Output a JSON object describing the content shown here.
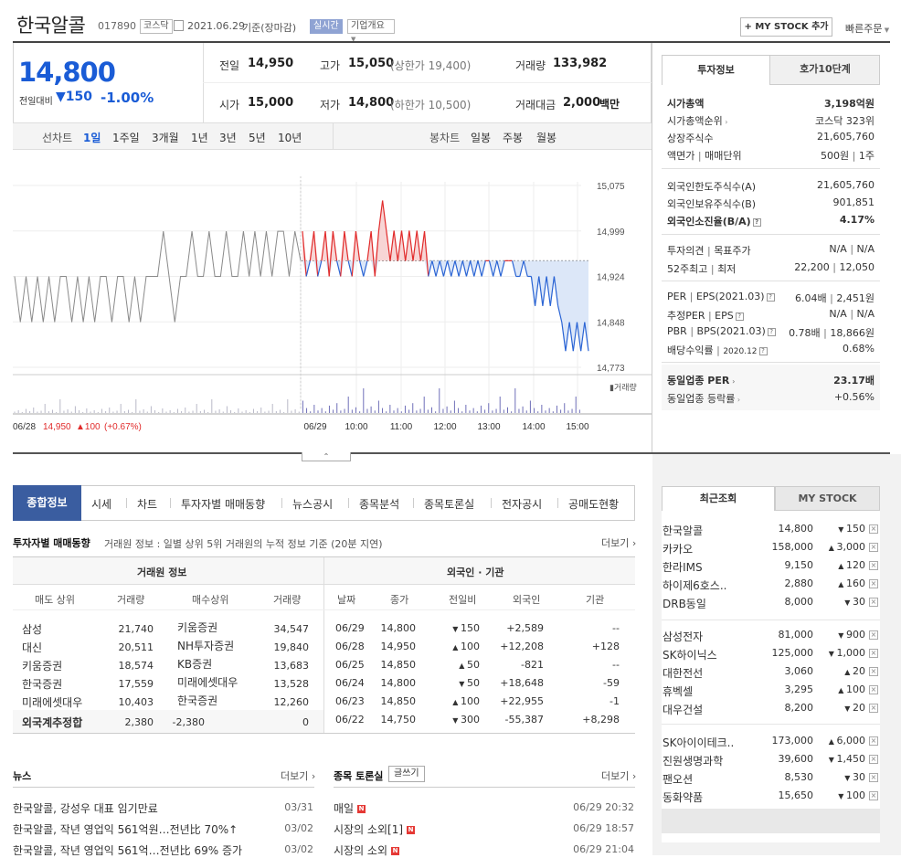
{
  "header": {
    "name": "한국알콜",
    "code": "017890",
    "market": "코스닥",
    "date": "2021.06.29",
    "basis": "기준(장마감)",
    "realtime": "실시간",
    "company_info": "기업개요",
    "mystock_btn": "MY STOCK 추가",
    "quick_order": "빠른주문"
  },
  "quote": {
    "price": "14,800",
    "change_label": "전일대비",
    "change": "150",
    "change_pct": "-1.00%",
    "prev_label": "전일",
    "prev": "14,950",
    "high_label": "고가",
    "high": "15,050",
    "upper_limit": "(상한가 19,400)",
    "volume_label": "거래량",
    "volume": "133,982",
    "open_label": "시가",
    "open": "15,000",
    "low_label": "저가",
    "low": "14,800",
    "lower_limit": "(하한가 10,500)",
    "amount_label": "거래대금",
    "amount": "2,000",
    "amount_unit": "백만"
  },
  "chart_tabs": {
    "line_label": "선차트",
    "periods": [
      "1일",
      "1주일",
      "3개월",
      "1년",
      "3년",
      "5년",
      "10년"
    ],
    "candle_label": "봉차트",
    "candles": [
      "일봉",
      "주봉",
      "월봉"
    ]
  },
  "chart_data": {
    "type": "line",
    "y_ticks": [
      "15,075",
      "14,999",
      "14,924",
      "14,848",
      "14,773"
    ],
    "ylim": [
      14773,
      15075
    ],
    "baseline": 14950,
    "x_ticks": [
      "06/29",
      "10:00",
      "11:00",
      "12:00",
      "13:00",
      "14:00",
      "15:00"
    ],
    "volume_label": "거래량",
    "prev_day_info": "06/28",
    "prev_day_price": "14,950",
    "prev_day_change": "100",
    "prev_day_pct": "(+0.67%)",
    "series": [
      {
        "values": [
          14924,
          14848,
          14924,
          14848,
          14924,
          14848,
          14924,
          14848,
          14924,
          14924,
          14848,
          14924,
          14848,
          14924,
          14848,
          14924,
          14924,
          14848,
          14924,
          14924,
          14848,
          14924,
          14848,
          14924,
          14924,
          14924,
          14999,
          14924,
          14848,
          14924,
          14924,
          14999,
          14924,
          14924,
          14999,
          14924,
          14924,
          14999,
          14924,
          14924,
          14999,
          14924,
          14999,
          14924,
          14999,
          14924,
          14999,
          14999,
          14924,
          14999,
          14950
        ]
      },
      {
        "values": [
          14999,
          14924,
          14950,
          14999,
          14924,
          14950,
          14999,
          14924,
          14999,
          14950,
          14924,
          14999,
          14950,
          14924,
          14999,
          14950,
          14924,
          14950,
          14999,
          14924,
          15000,
          15050,
          15000,
          14950,
          15000,
          14950,
          15000,
          14950,
          15000,
          14950,
          15000,
          14950,
          14999,
          14924,
          14950,
          14924,
          14950,
          14924,
          14950,
          14924,
          14950,
          14924,
          14950,
          14924,
          14950,
          14924,
          14950,
          14924,
          14950,
          14950,
          14924,
          14950,
          14924,
          14950,
          14950,
          14950,
          14924,
          14924,
          14950,
          14924,
          14924,
          14875,
          14924,
          14875,
          14924,
          14875,
          14924,
          14875,
          14848,
          14800,
          14848,
          14800,
          14848,
          14800,
          14848,
          14800
        ]
      }
    ]
  },
  "invest_tabs": [
    "투자정보",
    "호가10단계"
  ],
  "invest": {
    "market_cap_label": "시가총액",
    "market_cap": "3,198억원",
    "market_cap_rank_label": "시가총액순위",
    "market_cap_rank": "코스닥 323위",
    "listed_shares_label": "상장주식수",
    "listed_shares": "21,605,760",
    "face_value_label": "액면가",
    "trade_unit_label": "매매단위",
    "face_value": "500원",
    "trade_unit": "1주",
    "foreign_limit_label": "외국인한도주식수(A)",
    "foreign_limit": "21,605,760",
    "foreign_hold_label": "외국인보유주식수(B)",
    "foreign_hold": "901,851",
    "foreign_ratio_label": "외국인소진율(B/A)",
    "foreign_ratio": "4.17%",
    "opinion_label": "투자의견",
    "target_label": "목표주가",
    "opinion": "N/A",
    "target": "N/A",
    "week52_high_label": "52주최고",
    "week52_low_label": "최저",
    "week52_high": "22,200",
    "week52_low": "12,050",
    "per_label": "PER",
    "eps_label": "EPS(2021.03)",
    "per": "6.04배",
    "eps": "2,451원",
    "est_per_label": "추정PER",
    "est_eps_label": "EPS",
    "est_per": "N/A",
    "est_eps": "N/A",
    "pbr_label": "PBR",
    "bps_label": "BPS(2021.03)",
    "pbr": "0.78배",
    "bps": "18,866원",
    "div_label": "배당수익률",
    "div_date": "2020.12",
    "div": "0.68%",
    "sector_per_label": "동일업종 PER",
    "sector_per": "23.17배",
    "sector_rate_label": "동일업종 등락률",
    "sector_rate": "+0.56%"
  },
  "sub_tabs": [
    "종합정보",
    "시세",
    "차트",
    "투자자별 매매동향",
    "뉴스공시",
    "종목분석",
    "종목토론실",
    "전자공시",
    "공매도현황"
  ],
  "trading": {
    "title": "투자자별 매매동향",
    "desc": "거래원 정보 : 일별 상위 5위 거래원의 누적 정보 기준 (20분 지연)",
    "more": "더보기",
    "broker_header": "거래원 정보",
    "foreign_header": "외국인 · 기관",
    "cols_broker": [
      "매도 상위",
      "거래량",
      "매수상위",
      "거래량"
    ],
    "cols_foreign": [
      "날짜",
      "종가",
      "전일비",
      "외국인",
      "기관"
    ],
    "brokers": [
      {
        "sell": "삼성",
        "sv": "21,740",
        "buy": "키움증권",
        "bv": "34,547"
      },
      {
        "sell": "대신",
        "sv": "20,511",
        "buy": "NH투자증권",
        "bv": "19,840"
      },
      {
        "sell": "키움증권",
        "sv": "18,574",
        "buy": "KB증권",
        "bv": "13,683"
      },
      {
        "sell": "한국증권",
        "sv": "17,559",
        "buy": "미래에셋대우",
        "bv": "13,528"
      },
      {
        "sell": "미래에셋대우",
        "sv": "10,403",
        "buy": "한국증권",
        "bv": "12,260"
      }
    ],
    "foreign_sum_label": "외국계추정합",
    "foreign_sum_sell": "2,380",
    "foreign_sum_buy": "-2,380",
    "foreign_sum_net": "0",
    "daily": [
      {
        "date": "06/29",
        "close": "14,800",
        "dir": "down",
        "chg": "150",
        "foreign": "+2,589",
        "inst": "--"
      },
      {
        "date": "06/28",
        "close": "14,950",
        "dir": "up",
        "chg": "100",
        "foreign": "+12,208",
        "inst": "+128"
      },
      {
        "date": "06/25",
        "close": "14,850",
        "dir": "up",
        "chg": "50",
        "foreign": "-821",
        "inst": "--"
      },
      {
        "date": "06/24",
        "close": "14,800",
        "dir": "down",
        "chg": "50",
        "foreign": "+18,648",
        "inst": "-59"
      },
      {
        "date": "06/23",
        "close": "14,850",
        "dir": "up",
        "chg": "100",
        "foreign": "+22,955",
        "inst": "-1"
      },
      {
        "date": "06/22",
        "close": "14,750",
        "dir": "down",
        "chg": "300",
        "foreign": "-55,387",
        "inst": "+8,298"
      }
    ]
  },
  "news": {
    "title": "뉴스",
    "more": "더보기",
    "items": [
      {
        "title": "한국알콜, 강성우 대표 임기만료",
        "date": "03/31"
      },
      {
        "title": "한국알콜, 작년 영업익 561억원…전년比 70%↑",
        "date": "03/02"
      },
      {
        "title": "한국알콜, 작년 영업익 561억…전년比 69% 증가",
        "date": "03/02"
      }
    ]
  },
  "board": {
    "title": "종목 토론실",
    "write": "글쓰기",
    "more": "더보기",
    "items": [
      {
        "title": "매일",
        "date": "06/29 20:32"
      },
      {
        "title": "시장의 소외[1]",
        "date": "06/29 18:57"
      },
      {
        "title": "시장의 소외",
        "date": "06/29 21:04"
      }
    ]
  },
  "recent_tabs": [
    "최근조회",
    "MY STOCK"
  ],
  "recent": [
    {
      "name": "한국알콜",
      "price": "14,800",
      "dir": "down",
      "chg": "150"
    },
    {
      "name": "카카오",
      "price": "158,000",
      "dir": "up",
      "chg": "3,000"
    },
    {
      "name": "한라IMS",
      "price": "9,150",
      "dir": "up",
      "chg": "120"
    },
    {
      "name": "하이제6호스..",
      "price": "2,880",
      "dir": "up",
      "chg": "160"
    },
    {
      "name": "DRB동일",
      "price": "8,000",
      "dir": "down",
      "chg": "30"
    },
    {
      "name": "삼성전자",
      "price": "81,000",
      "dir": "down",
      "chg": "900"
    },
    {
      "name": "SK하이닉스",
      "price": "125,000",
      "dir": "down",
      "chg": "1,000"
    },
    {
      "name": "대한전선",
      "price": "3,060",
      "dir": "up",
      "chg": "20"
    },
    {
      "name": "휴벡셀",
      "price": "3,295",
      "dir": "up",
      "chg": "100"
    },
    {
      "name": "대우건설",
      "price": "8,200",
      "dir": "down",
      "chg": "20"
    },
    {
      "name": "SK아이이테크..",
      "price": "173,000",
      "dir": "up",
      "chg": "6,000"
    },
    {
      "name": "진원생명과학",
      "price": "39,600",
      "dir": "down",
      "chg": "1,450"
    },
    {
      "name": "팬오션",
      "price": "8,530",
      "dir": "down",
      "chg": "30"
    },
    {
      "name": "동화약품",
      "price": "15,650",
      "dir": "down",
      "chg": "100"
    }
  ]
}
